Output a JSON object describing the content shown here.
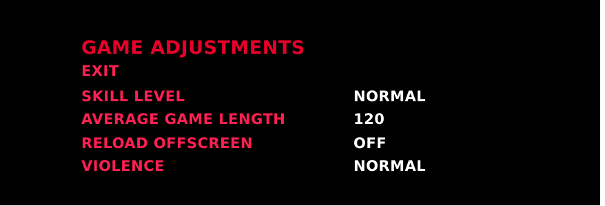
{
  "menu": {
    "title": "GAME ADJUSTMENTS",
    "items": [
      {
        "label": "EXIT",
        "value": ""
      },
      {
        "label": "SKILL LEVEL",
        "value": "NORMAL"
      },
      {
        "label": "AVERAGE GAME LENGTH",
        "value": "120"
      },
      {
        "label": "RELOAD OFFSCREEN",
        "value": "OFF"
      },
      {
        "label": "VIOLENCE",
        "value": "NORMAL"
      }
    ]
  },
  "colors": {
    "background": "#000000",
    "title": "#e8002a",
    "label": "#ff2052",
    "value": "#ffffff"
  }
}
